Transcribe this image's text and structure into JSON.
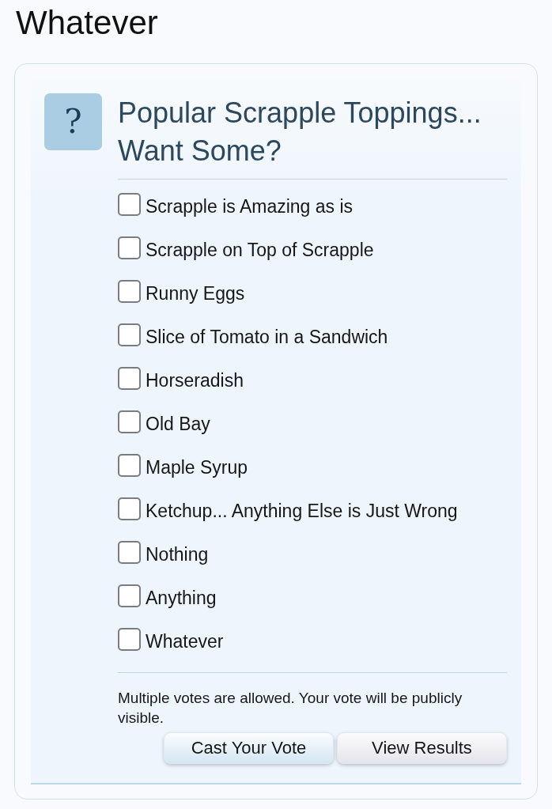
{
  "page": {
    "title": "Whatever"
  },
  "poll": {
    "icon": "?",
    "question": "Popular Scrapple Toppings... Want Some?",
    "options": [
      {
        "label": "Scrapple is Amazing as is",
        "checked": false
      },
      {
        "label": "Scrapple on Top of Scrapple",
        "checked": false
      },
      {
        "label": "Runny Eggs",
        "checked": false
      },
      {
        "label": "Slice of Tomato in a Sandwich",
        "checked": false
      },
      {
        "label": "Horseradish",
        "checked": false
      },
      {
        "label": "Old Bay",
        "checked": false
      },
      {
        "label": "Maple Syrup",
        "checked": false
      },
      {
        "label": "Ketchup... Anything Else is Just Wrong",
        "checked": false
      },
      {
        "label": "Nothing",
        "checked": false
      },
      {
        "label": "Anything",
        "checked": false
      },
      {
        "label": "Whatever",
        "checked": false
      }
    ],
    "note": "Multiple votes are allowed. Your vote will be publicly visible.",
    "buttons": [
      {
        "label": "Cast Your Vote",
        "kind": "primary"
      },
      {
        "label": "View Results",
        "kind": "secondary"
      }
    ]
  }
}
